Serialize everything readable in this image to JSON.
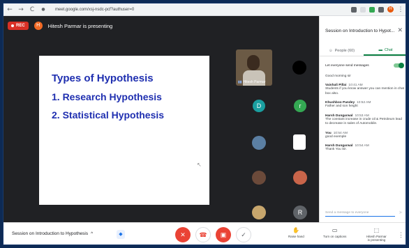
{
  "browser": {
    "url": "meet.google.com/xsj-nsdc-pcf?authuser=0",
    "nav": [
      "←",
      "→",
      "C"
    ]
  },
  "colors": {
    "accent_green": "#0b8043",
    "end_red": "#ea4335",
    "slide_text": "#1f2fb0",
    "stage_bg": "#202124"
  },
  "stage": {
    "rec_label": "REC",
    "presenter_initial": "H",
    "presenting_text": "Hitesh Parmar is presenting",
    "slide": {
      "title": "Types of Hypothesis",
      "items": [
        "1. Research Hypothesis",
        "2. Statistical Hypothesis"
      ]
    },
    "video_name": "Hitesh Parmar",
    "participants": [
      {
        "initial": "",
        "color": "#000000"
      },
      {
        "initial": "D",
        "color": "#1a9fa0"
      },
      {
        "initial": "r",
        "color": "#34a853"
      },
      {
        "initial": "",
        "color": "#5b7fa3"
      },
      {
        "initial": "",
        "color": "#ffffff"
      },
      {
        "initial": "",
        "color": "#6b4a3a"
      },
      {
        "initial": "",
        "color": "#c9654a"
      },
      {
        "initial": "",
        "color": "#c7a66d"
      },
      {
        "initial": "R",
        "color": "#5f6368"
      }
    ]
  },
  "bottombar": {
    "meeting_title": "Session on Introduction to Hypothesis",
    "chevron": "^",
    "actions": {
      "raise_hand": "Raise hand",
      "captions": "Turn on captions",
      "presenting": "Hitesh Parmar\nis presenting"
    }
  },
  "panel": {
    "title": "Session on Introduction to Hypot...",
    "tabs": {
      "people": "People (60)",
      "chat": "Chat"
    },
    "toggle_label": "Let everyone send messages",
    "messages": [
      {
        "author": "",
        "time": "",
        "text": "Good morning sir"
      },
      {
        "author": "Vaishali Pillai",
        "time": "10:41 AM",
        "text": "Students if you know answer you can mention in chat box also."
      },
      {
        "author": "Khushboo Pandey",
        "time": "10:52 AM",
        "text": "Father and son height"
      },
      {
        "author": "Harsh Dungarwal",
        "time": "10:53 AM",
        "text": "The constant increase in crude oil & Petroleum lead to decrease in sales of Automobile."
      },
      {
        "author": "You",
        "time": "10:54 AM",
        "text": "good exemple"
      },
      {
        "author": "Harsh Dungarwal",
        "time": "10:54 AM",
        "text": "Thank You Sir."
      }
    ],
    "input_placeholder": "Send a message to everyone"
  }
}
